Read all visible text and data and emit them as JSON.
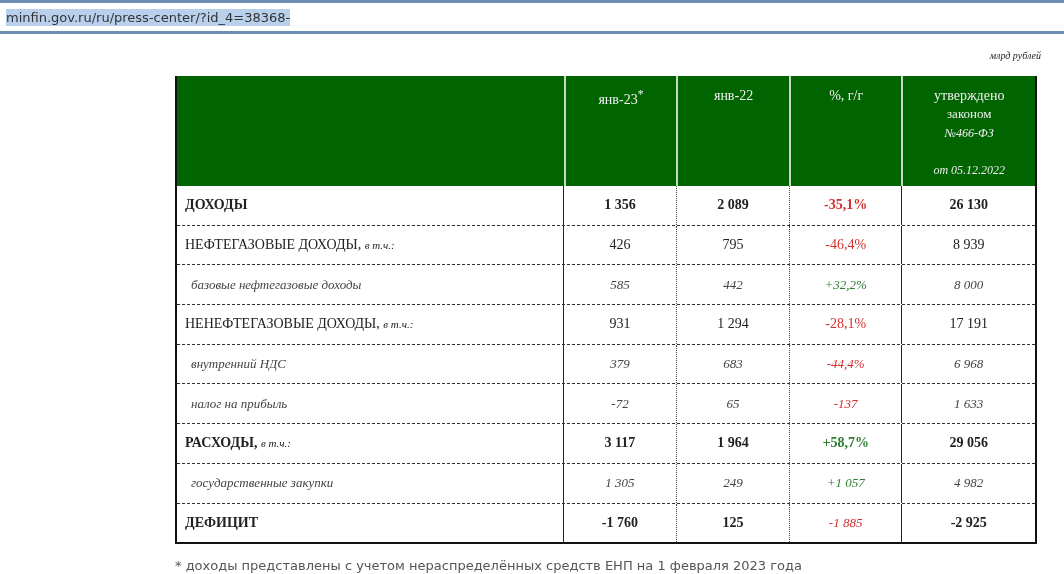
{
  "address_bar": {
    "url": "minfin.gov.ru/ru/press-center/?id_4=38368-",
    "selected": true
  },
  "unit": "млрд рублей",
  "table": {
    "columns": [
      {},
      {
        "lines": [
          "янв-23$^{*}$"
        ]
      },
      {
        "lines": [
          "янв-22"
        ]
      },
      {
        "lines": [
          "%, г/г"
        ]
      },
      {
        "lines": [
          "утверждено",
          "законом",
          "№466-ФЗ",
          "от 05.12.2022"
        ]
      }
    ],
    "rows": [
      {
        "kind": "bold",
        "label": "ДОХОДЫ",
        "values": [
          "1 356",
          "2 089"
        ],
        "change": {
          "text": "-35,1%",
          "color": "#d32f2f",
          "kind": "bold"
        },
        "approved": "26 130"
      },
      {
        "kind": "plain",
        "label": "НЕФТЕГАЗОВЫЕ ДОХОДЫ, *в т.ч.:*",
        "values": [
          "426",
          "795"
        ],
        "change": {
          "text": "-46,4%",
          "color": "#d32f2f",
          "kind": "plain"
        },
        "approved": "8 939"
      },
      {
        "kind": "sub",
        "label": "базовые нефтегазовые доходы",
        "values": [
          "585",
          "442"
        ],
        "change": {
          "text": "+32,2%",
          "color": "#2e7d32",
          "kind": "italic"
        },
        "approved": "8 000"
      },
      {
        "kind": "plain",
        "label": "НЕНЕФТЕГАЗОВЫЕ ДОХОДЫ, *в т.ч.:*",
        "values": [
          "931",
          "1 294"
        ],
        "change": {
          "text": "-28,1%",
          "color": "#d32f2f",
          "kind": "plain"
        },
        "approved": "17 191"
      },
      {
        "kind": "sub",
        "label": "внутренний НДС",
        "values": [
          "379",
          "683"
        ],
        "change": {
          "text": "-44,4%",
          "color": "#d32f2f",
          "kind": "italic"
        },
        "approved": "6 968"
      },
      {
        "kind": "sub",
        "label": "налог на прибыль",
        "values": [
          "-72",
          "65"
        ],
        "change": {
          "text": "-137",
          "color": "#d32f2f",
          "kind": "italic"
        },
        "approved": "1 633"
      },
      {
        "kind": "bold",
        "label": "РАСХОДЫ, *в т.ч.:*",
        "values": [
          "3 117",
          "1 964"
        ],
        "change": {
          "text": "+58,7%",
          "color": "#2e7d32",
          "kind": "bold"
        },
        "approved": "29 056"
      },
      {
        "kind": "sub",
        "label": "государственные закупки",
        "values": [
          "1 305",
          "249"
        ],
        "change": {
          "text": "+1 057",
          "color": "#2e7d32",
          "kind": "italic"
        },
        "approved": "4 982"
      },
      {
        "kind": "bold",
        "label": "ДЕФИЦИТ",
        "values": [
          "-1 760",
          "125"
        ],
        "change": {
          "text": "-1 885",
          "color": "#d32f2f",
          "kind": "italic"
        },
        "approved": "-2 925"
      }
    ]
  },
  "footnote": "* доходы представлены с учетом нераспределённых средств ЕНП на 1 февраля 2023 года"
}
